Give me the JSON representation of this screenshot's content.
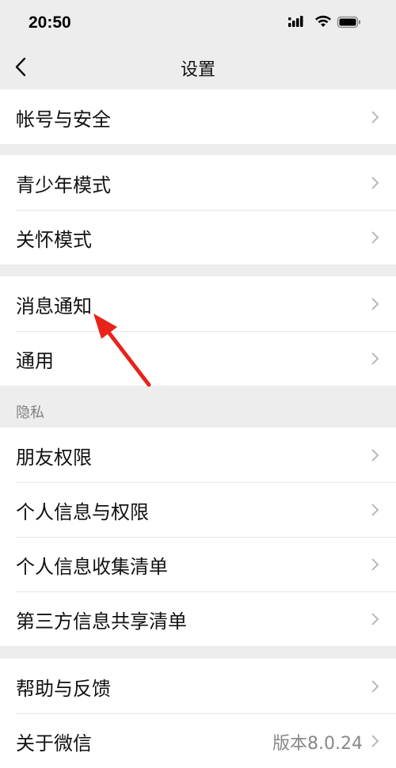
{
  "status_bar": {
    "time": "20:50"
  },
  "nav": {
    "title": "设置"
  },
  "groups": {
    "account": [
      {
        "label": "帐号与安全"
      }
    ],
    "modes": [
      {
        "label": "青少年模式"
      },
      {
        "label": "关怀模式"
      }
    ],
    "general": [
      {
        "label": "消息通知"
      },
      {
        "label": "通用"
      }
    ],
    "privacy_header": "隐私",
    "privacy": [
      {
        "label": "朋友权限"
      },
      {
        "label": "个人信息与权限"
      },
      {
        "label": "个人信息收集清单"
      },
      {
        "label": "第三方信息共享清单"
      }
    ],
    "about": [
      {
        "label": "帮助与反馈"
      },
      {
        "label": "关于微信",
        "value": "版本8.0.24"
      }
    ]
  },
  "icons": {
    "back": "chevron-left-icon",
    "row_arrow": "chevron-right-icon",
    "annotation": "red-arrow-icon"
  },
  "colors": {
    "annotation_arrow": "#e8231b",
    "background": "#ededed"
  }
}
